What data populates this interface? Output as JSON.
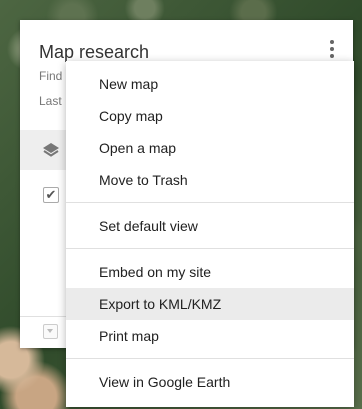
{
  "panel": {
    "title": "Map research",
    "line1": "Find",
    "line2": "Last"
  },
  "menu": {
    "items": [
      {
        "label": "New map"
      },
      {
        "label": "Copy map"
      },
      {
        "label": "Open a map"
      },
      {
        "label": "Move to Trash"
      },
      {
        "label": "Set default view"
      },
      {
        "label": "Embed on my site"
      },
      {
        "label": "Export to KML/KMZ",
        "highlighted": true
      },
      {
        "label": "Print map"
      },
      {
        "label": "View in Google Earth"
      }
    ]
  },
  "icons": {
    "more": "more-vert-icon",
    "layers": "layers-icon",
    "checkbox": "checkbox-checked-icon",
    "collapse": "chevron-down-icon"
  }
}
